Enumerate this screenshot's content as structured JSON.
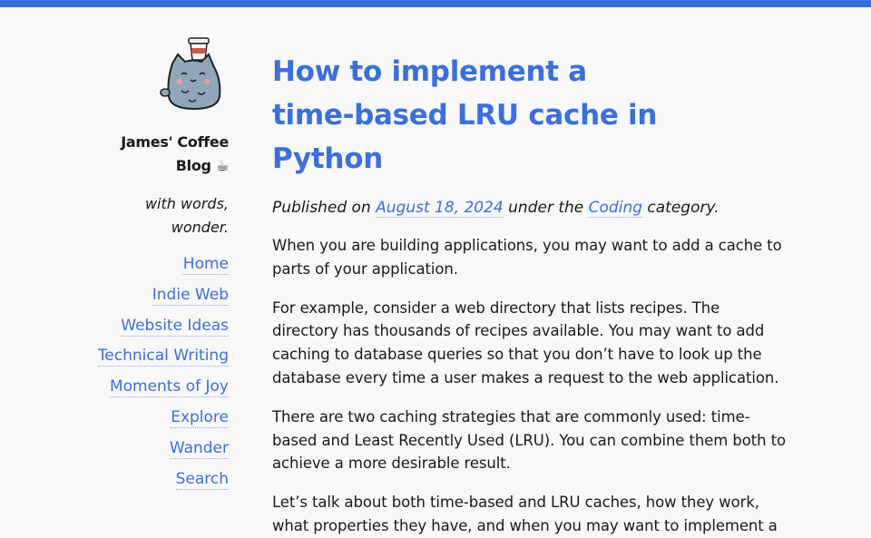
{
  "colors": {
    "accent": "#3b6fdc",
    "background": "#f8f8f8",
    "text": "#1a1a1a"
  },
  "sidebar": {
    "logo_icon": "cat-with-coffee-cup-icon",
    "blog_title_line1": "James' Coffee",
    "blog_title_line2": "Blog ☕",
    "tagline_line1": "with words,",
    "tagline_line2": "wonder.",
    "nav": [
      {
        "label": "Home"
      },
      {
        "label": "Indie Web"
      },
      {
        "label": "Website Ideas"
      },
      {
        "label": "Technical Writing"
      },
      {
        "label": "Moments of Joy"
      },
      {
        "label": "Explore"
      },
      {
        "label": "Wander"
      },
      {
        "label": "Search"
      }
    ]
  },
  "post": {
    "title": "How to implement a time-based LRU cache in Python",
    "meta_prefix": "Published on ",
    "date": "August 18, 2024",
    "meta_middle": " under the ",
    "category": "Coding",
    "meta_suffix": " category.",
    "paragraphs": [
      "When you are building applications, you may want to add a cache to parts of your application.",
      "For example, consider a web directory that lists recipes. The directory has thousands of recipes available. You may want to add caching to database queries so that you don’t have to look up the database every time a user makes a request to the web application.",
      "There are two caching strategies that are commonly used: time-based and Least Recently Used (LRU). You can combine them both to achieve a more desirable result.",
      "Let’s talk about both time-based and LRU caches, how they work, what properties they have, and when you may want to implement a"
    ]
  }
}
